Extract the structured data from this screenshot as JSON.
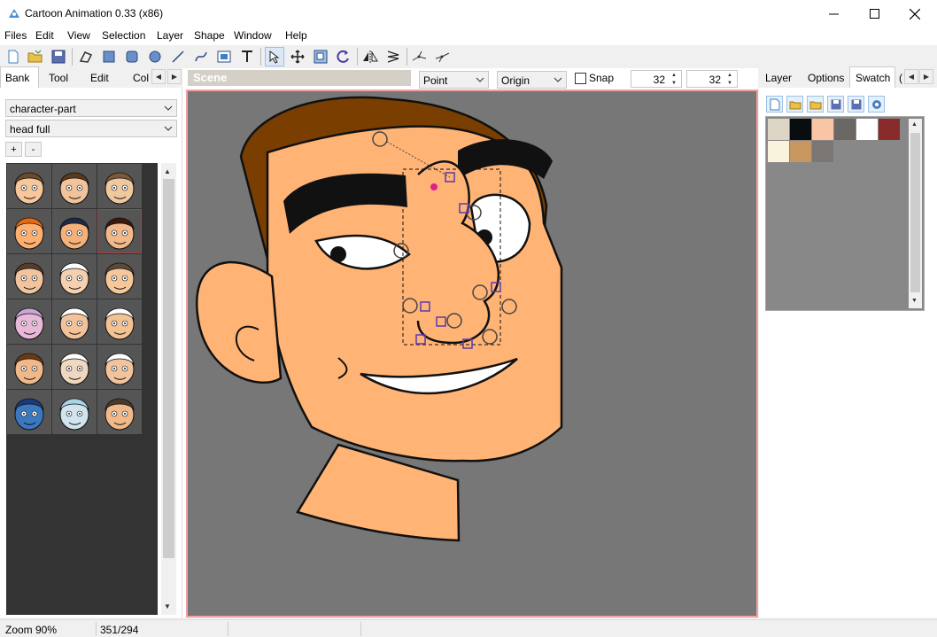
{
  "window": {
    "title": "Cartoon Animation 0.33 (x86)",
    "minimize_icon": "minimize-icon",
    "maximize_icon": "maximize-icon",
    "close_icon": "close-icon"
  },
  "menu": [
    "Files",
    "Edit",
    "View",
    "Selection",
    "Layer",
    "Shape",
    "Window",
    "Help"
  ],
  "toolbar": {
    "icons": [
      "new-file-icon",
      "open-folder-icon",
      "save-icon",
      "polygon-select-icon",
      "rectangle-icon",
      "rounded-rect-icon",
      "ellipse-icon",
      "line-icon",
      "curve-icon",
      "image-icon",
      "text-icon",
      "edit-points-icon",
      "move-icon",
      "scale-icon",
      "rotate-icon",
      "flip-horizontal-icon",
      "skew-icon",
      "curve-edit-icon",
      "curve-edit-2-icon"
    ]
  },
  "left_tabs": [
    "Bank",
    "Tool",
    "Edit",
    "Col"
  ],
  "scene": {
    "header": "Scene",
    "mode": "Point",
    "anchor": "Origin",
    "snap_label": "Snap",
    "grid_x": "32",
    "grid_y": "32"
  },
  "right_tabs": [
    "Layer",
    "Options",
    "Swatch",
    "("
  ],
  "bank": {
    "category": "character-part",
    "subcategory": "head full",
    "add_label": "+",
    "remove_label": "-"
  },
  "swatch": {
    "colors": [
      "#ddd5c6",
      "#090d10",
      "#f9c5a5",
      "#6b6864",
      "#ffffff",
      "#8a2b2b",
      "#f9f3dd",
      "#c7975f",
      "#7b7774"
    ]
  },
  "status": {
    "zoom": "Zoom 90%",
    "coords": "351/294"
  }
}
